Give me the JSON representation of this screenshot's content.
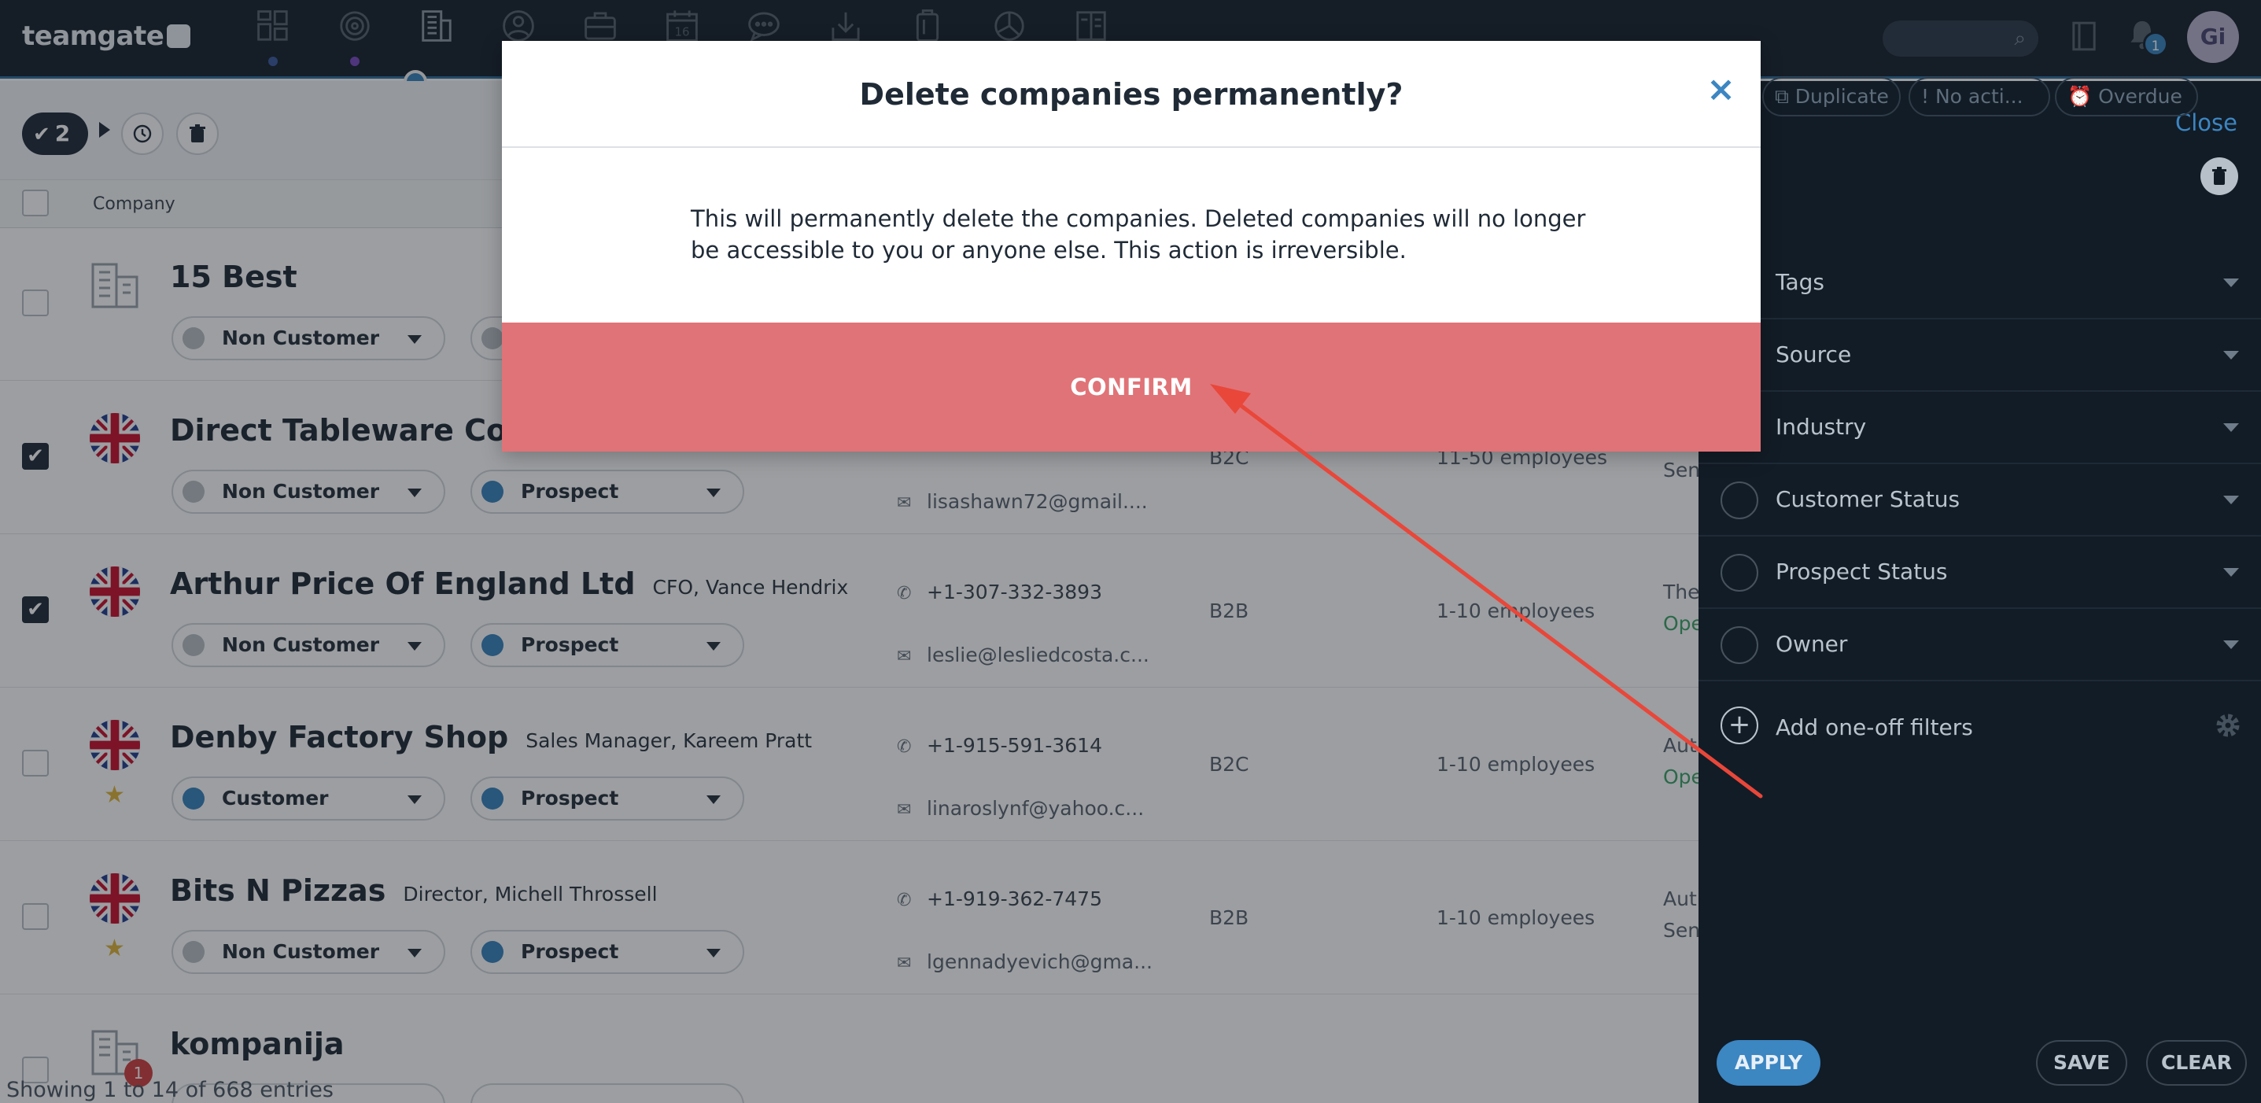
{
  "app": {
    "logo_text": "teamgate"
  },
  "nav": {
    "icons": [
      "dashboard-icon",
      "target-icon",
      "companies-icon",
      "people-icon",
      "deals-icon",
      "calendar-icon",
      "chat-icon",
      "download-icon",
      "documents-icon",
      "reports-icon",
      "invoices-icon"
    ],
    "calendar_day": "16",
    "notification_count": "1",
    "avatar_initials": "Gi"
  },
  "toolbar": {
    "selected_count": "2"
  },
  "table": {
    "header_company": "Company",
    "rows": [
      {
        "name": "15 Best",
        "contact": "",
        "checked": false,
        "starred": false,
        "status1": "Non Customer",
        "status2": "",
        "phone": "",
        "email": "",
        "btype": "",
        "bsize": "",
        "note": "",
        "note2": ""
      },
      {
        "name": "Direct Tableware Co Ltd",
        "contact": "",
        "checked": true,
        "starred": false,
        "status1": "Non Customer",
        "status2": "Prospect",
        "phone": "",
        "email": "lisashawn72@gmail....",
        "btype": "B2C",
        "bsize": "11-50 employees",
        "note": "Sen",
        "note2": ""
      },
      {
        "name": "Arthur Price Of England Ltd",
        "contact": "CFO, Vance Hendrix",
        "checked": true,
        "starred": false,
        "status1": "Non Customer",
        "status2": "Prospect",
        "phone": "+1-307-332-3893",
        "email": "leslie@lesliedcosta.c...",
        "btype": "B2B",
        "bsize": "1-10 employees",
        "note": "The",
        "note2": "Ope"
      },
      {
        "name": "Denby Factory Shop",
        "contact": "Sales Manager, Kareem Pratt",
        "checked": false,
        "starred": true,
        "status1": "Customer",
        "status2": "Prospect",
        "phone": "+1-915-591-3614",
        "email": "linaroslynf@yahoo.c...",
        "btype": "B2C",
        "bsize": "1-10 employees",
        "note": "Aut",
        "note2": "Ope"
      },
      {
        "name": "Bits N Pizzas",
        "contact": "Director, Michell Throssell",
        "checked": false,
        "starred": true,
        "status1": "Non Customer",
        "status2": "Prospect",
        "phone": "+1-919-362-7475",
        "email": "lgennadyevich@gma...",
        "btype": "B2B",
        "bsize": "1-10 employees",
        "note": "Aut",
        "note2": "Sen"
      },
      {
        "name": "kompanija",
        "contact": "",
        "checked": false,
        "starred": false,
        "status1": "",
        "status2": "",
        "phone": "",
        "email": "",
        "btype": "",
        "bsize": "",
        "note": "",
        "note2": ""
      }
    ],
    "row_badge": "1",
    "footer": "Showing 1 to 14 of 668 entries"
  },
  "panel": {
    "close_label": "Close",
    "quick_filters": [
      "Duplicate",
      "No acti...",
      "Overdue"
    ],
    "filters": [
      "Tags",
      "Source",
      "Industry",
      "Customer Status",
      "Prospect Status",
      "Owner"
    ],
    "add_filter_label": "Add one-off filters",
    "apply_label": "APPLY",
    "save_label": "SAVE",
    "clear_label": "CLEAR"
  },
  "modal": {
    "title": "Delete companies permanently?",
    "close_symbol": "×",
    "body": "This will permanently delete the companies. Deleted companies will no longer be accessible to you or anyone else. This action is irreversible.",
    "confirm_label": "CONFIRM"
  },
  "colors": {
    "nav_bg": "#18222d",
    "accent": "#3c86c2",
    "confirm_bg": "#e07377",
    "annotation_arrow": "#e8473a",
    "customer_dot": "#3a84bd",
    "non_customer_dot": "#b9bfc5",
    "open_green": "#3fa36a"
  }
}
